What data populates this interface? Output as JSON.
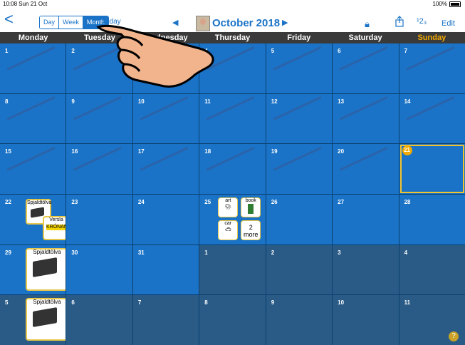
{
  "status": {
    "time": "10:08  Sun 21 Oct",
    "battery": "100%"
  },
  "toolbar": {
    "back": "<",
    "segments": [
      {
        "label": "Day",
        "active": false
      },
      {
        "label": "Week",
        "active": false
      },
      {
        "label": "Month",
        "active": true
      }
    ],
    "today": "Today",
    "month_title": "October 2018",
    "numbers_label": "¹2₃",
    "edit": "Edit"
  },
  "weekdays": [
    "Monday",
    "Tuesday",
    "Wednesday",
    "Thursday",
    "Friday",
    "Saturday",
    "Sunday"
  ],
  "weeks": [
    [
      "1",
      "2",
      "3",
      "4",
      "5",
      "6",
      "7"
    ],
    [
      "8",
      "9",
      "10",
      "11",
      "12",
      "13",
      "14"
    ],
    [
      "15",
      "16",
      "17",
      "18",
      "19",
      "20",
      "21"
    ],
    [
      "22",
      "23",
      "24",
      "25",
      "26",
      "27",
      "28"
    ],
    [
      "29",
      "30",
      "31",
      "1",
      "2",
      "3",
      "4"
    ],
    [
      "5",
      "6",
      "7",
      "8",
      "9",
      "10",
      "11"
    ]
  ],
  "events": {
    "day22": [
      "Spjaldtölva",
      "Versla",
      "KRÓNAN"
    ],
    "day25": [
      "art",
      "book",
      "car",
      "2\nmore"
    ],
    "day29": "Spjaldtölva",
    "day5": "Spjaldtölva"
  },
  "colors": {
    "accent": "#1a73c7",
    "sunday": "#f2a900",
    "today": "#f2c12e"
  }
}
